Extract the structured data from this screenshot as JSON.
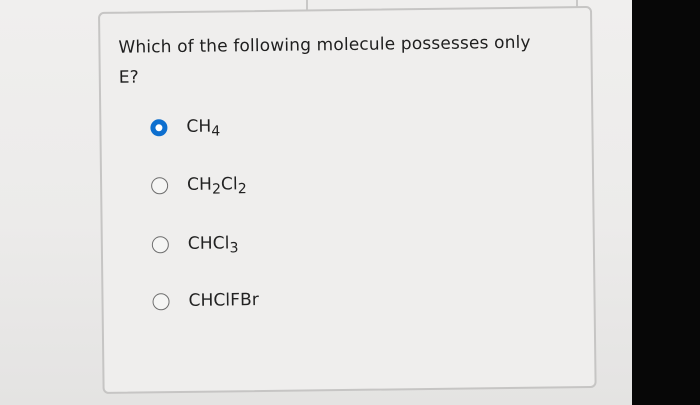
{
  "question": {
    "text": "Which of the following molecule possesses only E?"
  },
  "options": [
    {
      "selected": true,
      "label_parts": {
        "p1": "CH",
        "p2": "4"
      }
    },
    {
      "selected": false,
      "label_parts": {
        "p1": "CH",
        "p2": "2",
        "p3": "Cl",
        "p4": "2"
      }
    },
    {
      "selected": false,
      "label_parts": {
        "p1": "CHCl",
        "p2": "3"
      }
    },
    {
      "selected": false,
      "label_parts": {
        "p1": "CHClFBr"
      }
    }
  ],
  "colors": {
    "selected_radio": "#0d6fcf",
    "background": "#070707",
    "card": "#efeeed"
  }
}
